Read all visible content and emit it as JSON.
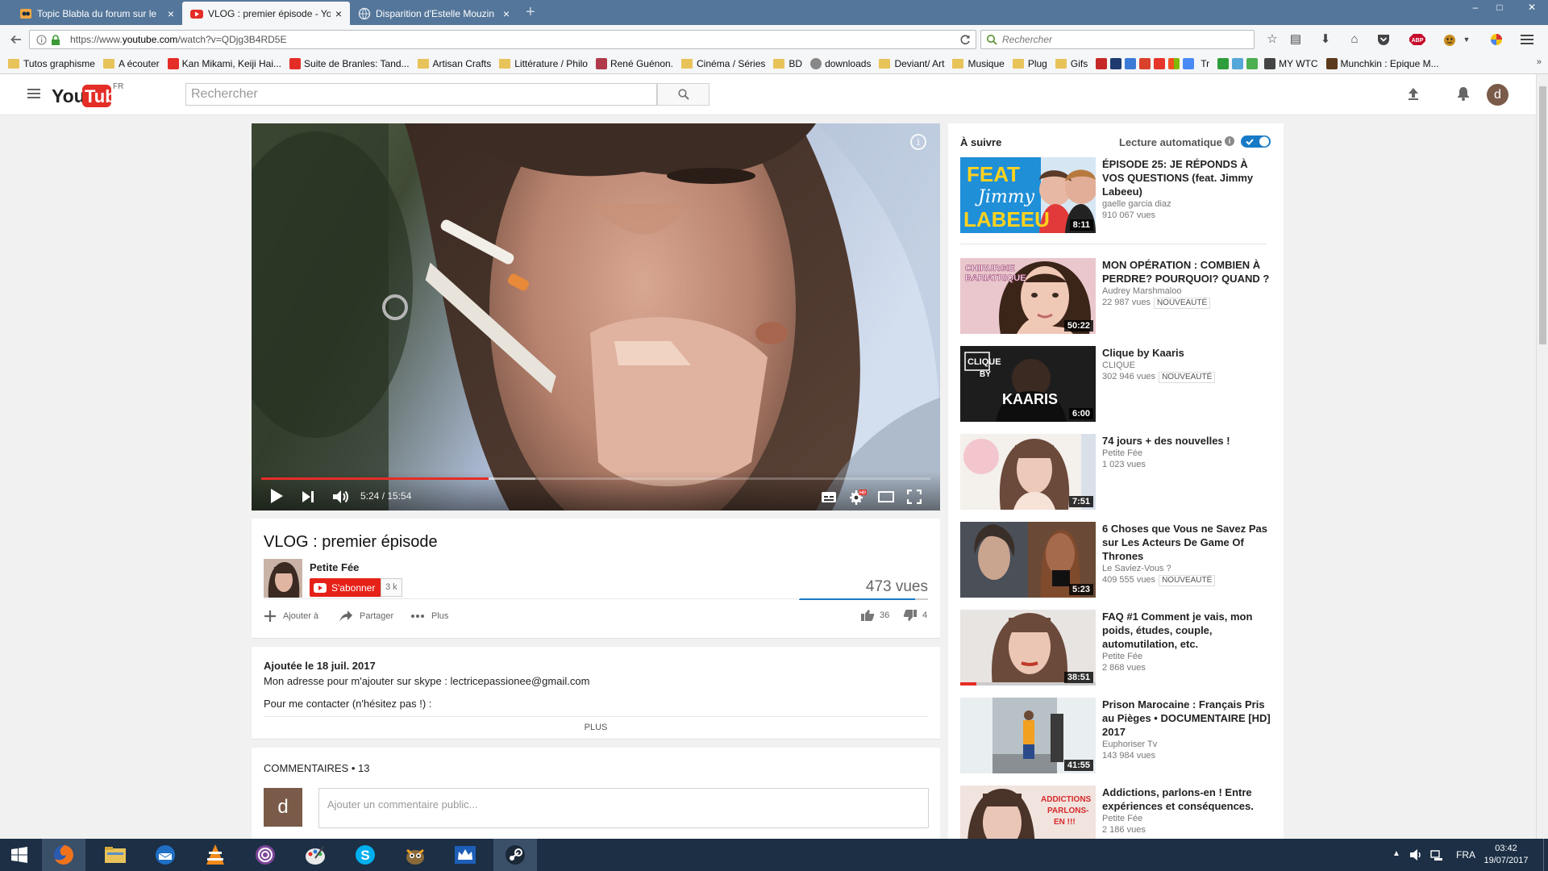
{
  "browser": {
    "tabs": [
      {
        "label": "Topic Blabla du forum sur le",
        "active": false
      },
      {
        "label": "VLOG : premier épisode - Yo",
        "active": true
      },
      {
        "label": "Disparition d'Estelle Mouzin",
        "active": false
      }
    ],
    "url_prefix": "https://www.",
    "url_domain": "youtube.com",
    "url_path": "/watch?v=QDjg3B4RD5E",
    "search_placeholder": "Rechercher",
    "bookmarks": [
      {
        "label": "Tutos graphisme",
        "icon": "folder-icon"
      },
      {
        "label": "A écouter",
        "icon": "folder-icon"
      },
      {
        "label": "Kan Mikami, Keiji Hai...",
        "icon": "youtube-icon"
      },
      {
        "label": "Suite de Branles: Tand...",
        "icon": "youtube-icon"
      },
      {
        "label": "Artisan Crafts",
        "icon": "folder-icon"
      },
      {
        "label": "Littérature / Philo",
        "icon": "folder-icon"
      },
      {
        "label": "René Guénon.",
        "icon": "book-icon"
      },
      {
        "label": "Cinéma / Séries",
        "icon": "folder-icon"
      },
      {
        "label": "BD",
        "icon": "folder-icon"
      },
      {
        "label": "downloads",
        "icon": "globe-icon"
      },
      {
        "label": "Deviant/ Art",
        "icon": "folder-icon"
      },
      {
        "label": "Musique",
        "icon": "folder-icon"
      },
      {
        "label": "Plug",
        "icon": "folder-icon"
      },
      {
        "label": "Gifs",
        "icon": "folder-icon"
      },
      {
        "label": "Tr",
        "icon": "translate-icon"
      },
      {
        "label": "MY WTC",
        "icon": "site-icon"
      },
      {
        "label": "Munchkin : Epique M...",
        "icon": "site-icon"
      }
    ]
  },
  "yt": {
    "logo": "YouTube",
    "region": "FR",
    "search_placeholder": "Rechercher",
    "avatar_letter": "d",
    "player": {
      "time": "5:24 / 15:54",
      "progress": 0.34,
      "loaded": 0.41
    },
    "video": {
      "title": "VLOG : premier épisode",
      "channel": "Petite Fée",
      "subscribe": "S'abonner",
      "subs": "3 k",
      "views": "473 vues",
      "add_to": "Ajouter à",
      "share": "Partager",
      "more": "Plus",
      "likes": "36",
      "dislikes": "4"
    },
    "description": {
      "date": "Ajoutée le 18 juil. 2017",
      "line1": "Mon adresse pour m'ajouter sur skype : lectricepassionee@gmail.com",
      "line2": "Pour me contacter (n'hésitez pas !) :",
      "more": "PLUS"
    },
    "comments": {
      "header": "COMMENTAIRES • 13",
      "placeholder": "Ajouter un commentaire public...",
      "avatar_letter": "d"
    },
    "sidebar": {
      "up_next": "À suivre",
      "autoplay": "Lecture automatique",
      "items": [
        {
          "title": "ÉPISODE 25: JE RÉPONDS À VOS QUESTIONS (feat. Jimmy Labeeu)",
          "channel": "gaelle garcia diaz",
          "views": "910 067 vues",
          "duration": "8:11",
          "badge": "",
          "thumb_text": "FEAT Jimmy LABEEU"
        },
        {
          "title": "MON OPÉRATION : COMBIEN À PERDRE? POURQUOI? QUAND ?",
          "channel": "Audrey Marshmaloo",
          "views": "22 987 vues",
          "duration": "50:22",
          "badge": "NOUVEAUTÉ",
          "thumb_text": "CHIRURGIE BARIATRIQUE"
        },
        {
          "title": "Clique by Kaaris",
          "channel": "CLIQUE",
          "views": "302 946 vues",
          "duration": "6:00",
          "badge": "NOUVEAUTÉ",
          "thumb_text": "KAARIS"
        },
        {
          "title": "74 jours + des nouvelles !",
          "channel": "Petite Fée",
          "views": "1 023 vues",
          "duration": "7:51",
          "badge": "",
          "thumb_text": ""
        },
        {
          "title": "6 Choses que Vous ne Savez Pas sur Les Acteurs De Game Of Thrones",
          "channel": "Le Saviez-Vous ?",
          "views": "409 555 vues",
          "duration": "5:23",
          "badge": "NOUVEAUTÉ",
          "thumb_text": ""
        },
        {
          "title": "FAQ #1 Comment je vais, mon poids, études, couple, automutilation, etc.",
          "channel": "Petite Fée",
          "views": "2 868 vues",
          "duration": "38:51",
          "badge": "",
          "thumb_text": ""
        },
        {
          "title": "Prison Marocaine : Français Pris au Pièges • DOCUMENTAIRE [HD] 2017",
          "channel": "Euphoriser Tv",
          "views": "143 984 vues",
          "duration": "41:55",
          "badge": "",
          "thumb_text": ""
        },
        {
          "title": "Addictions, parlons-en ! Entre expériences et conséquences.",
          "channel": "Petite Fée",
          "views": "2 186 vues",
          "duration": "",
          "badge": "",
          "thumb_text": "ADDICTIONS PARLONS-EN !!!"
        }
      ]
    }
  },
  "taskbar": {
    "lang": "FRA",
    "time": "03:42",
    "date": "19/07/2017"
  },
  "colors": {
    "youtube_red": "#e52d27",
    "tab_strip": "#54769a",
    "taskbar": "#1c2f45",
    "autoplay_toggle": "#167ac6"
  }
}
